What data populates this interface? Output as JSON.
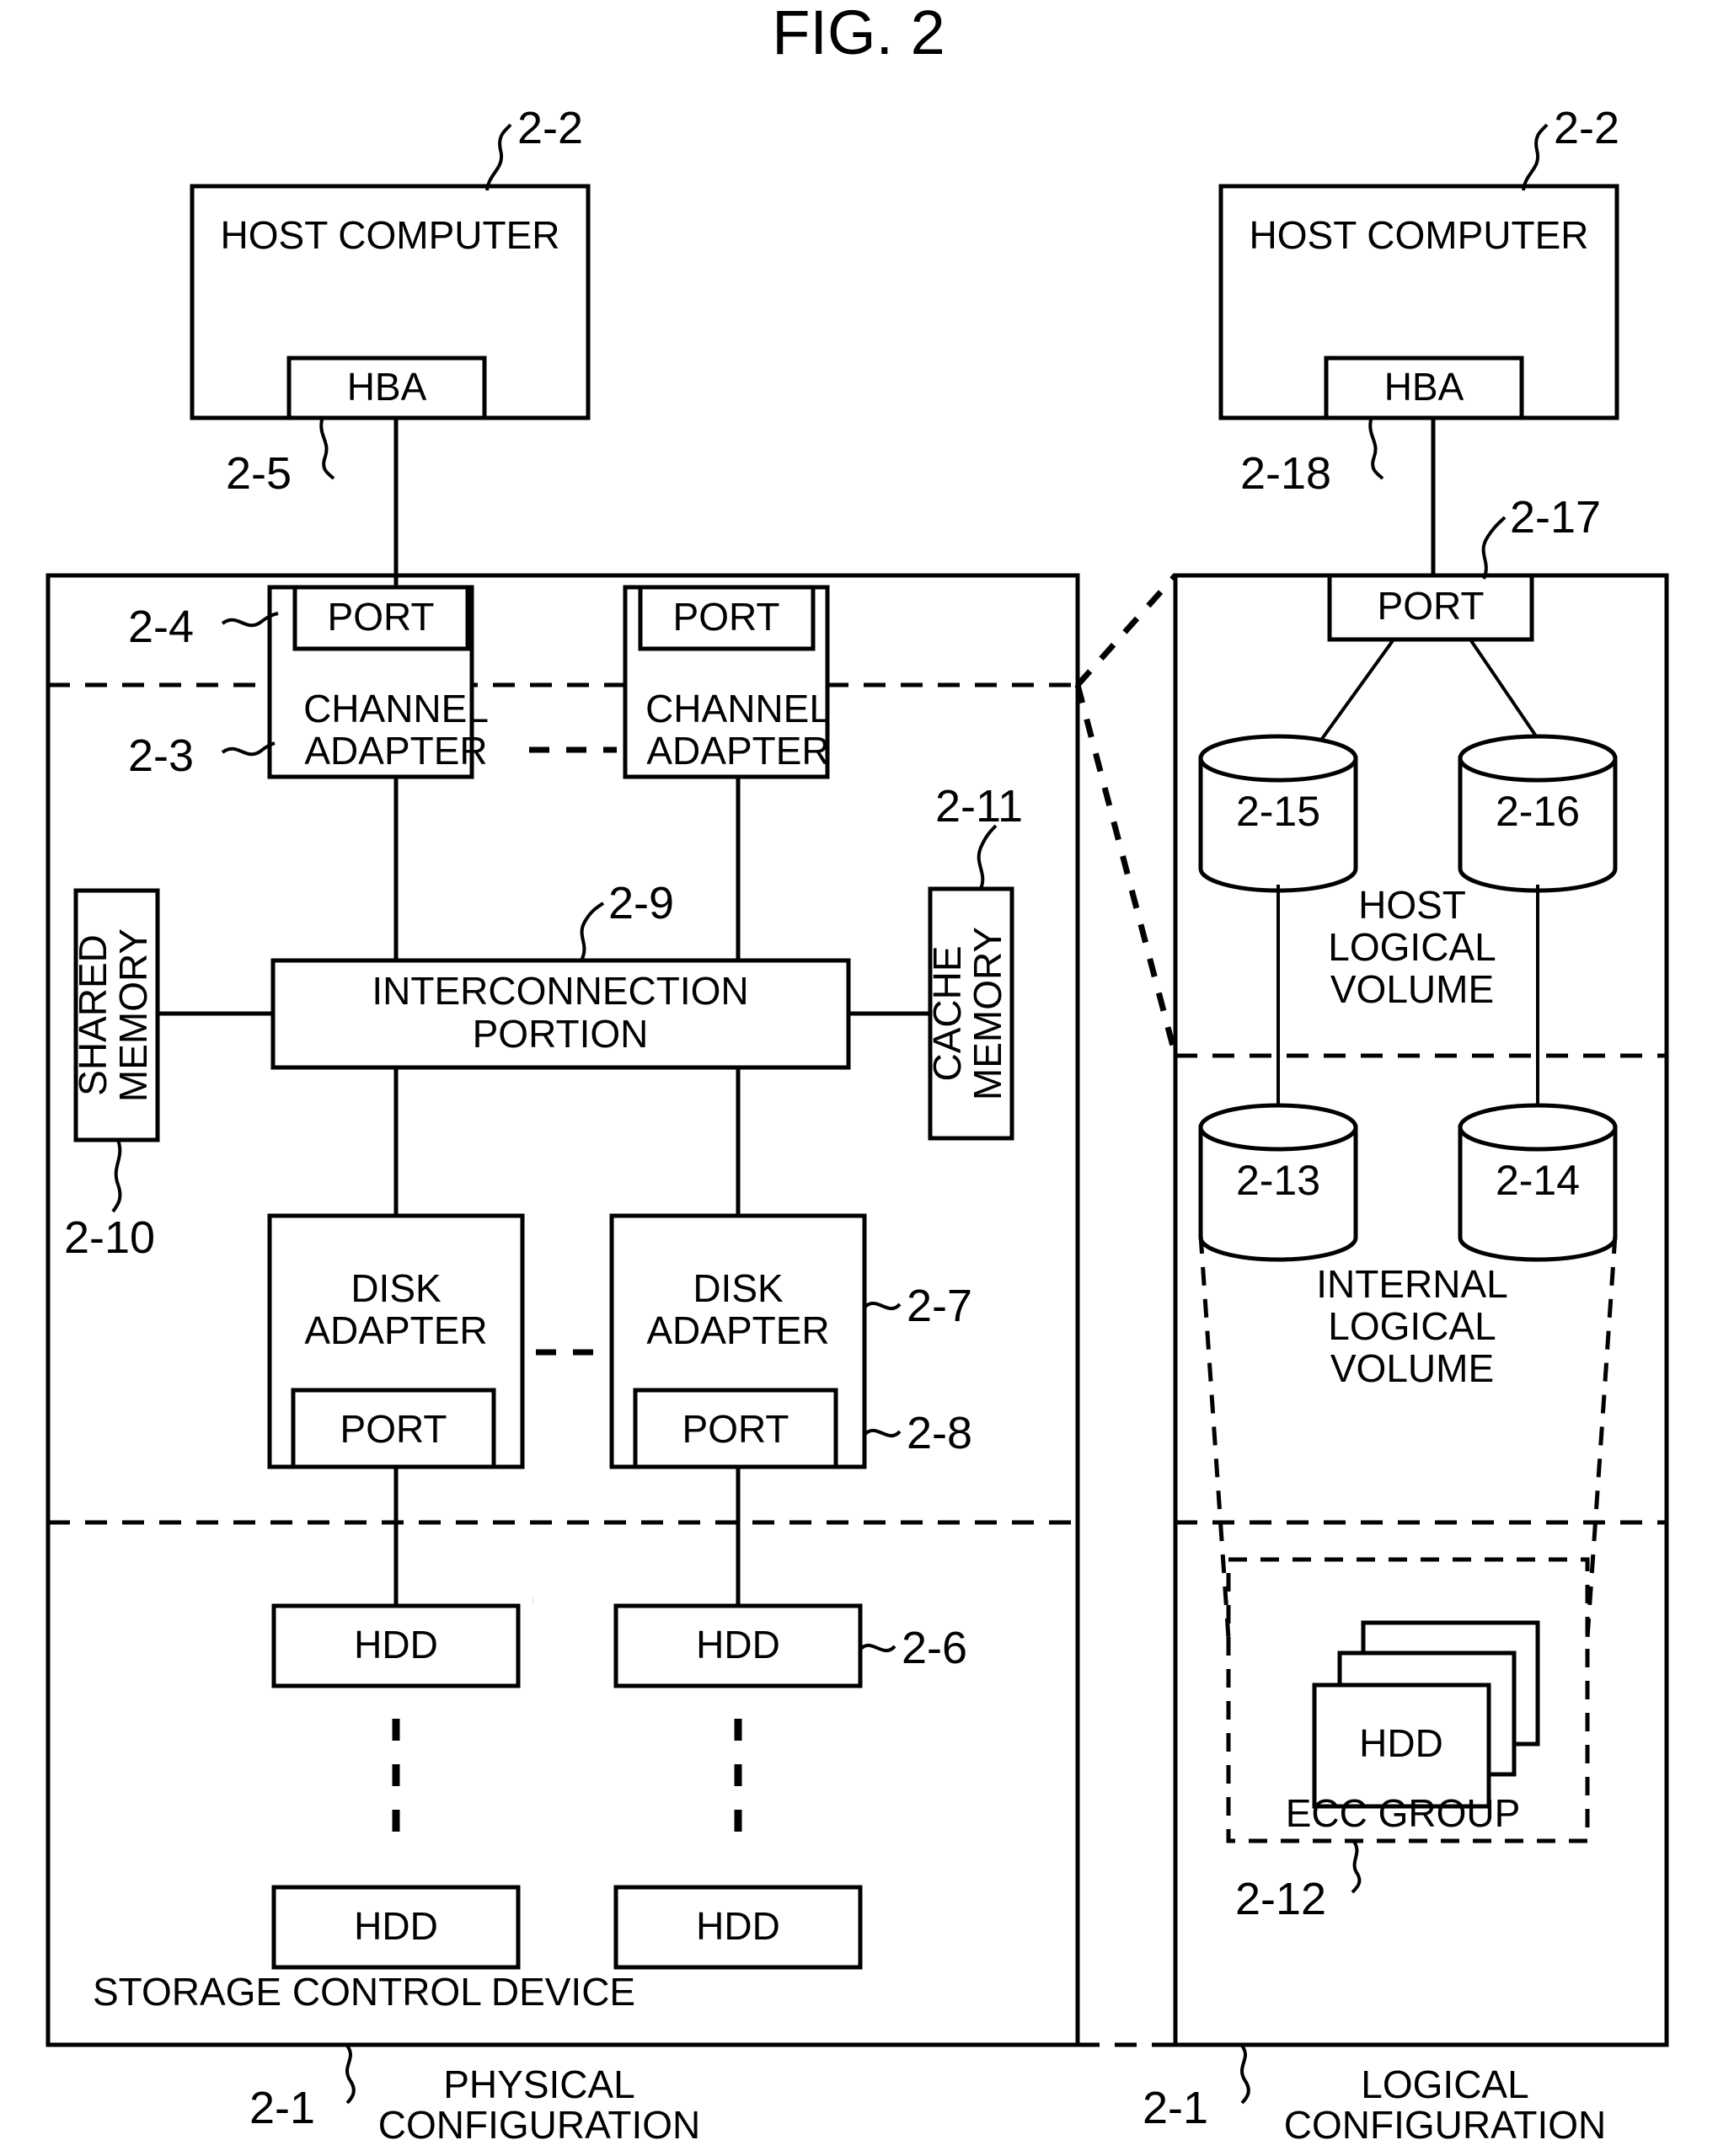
{
  "figure": {
    "title": "FIG. 2"
  },
  "left_panel": {
    "caption_ref": "2-1",
    "caption_line1": "PHYSICAL",
    "caption_line2": "CONFIGURATION",
    "device_label": "STORAGE CONTROL DEVICE",
    "host_computer": {
      "label": "HOST COMPUTER",
      "ref": "2-2",
      "hba_label": "HBA",
      "hba_ref": "2-5"
    },
    "channel_adapters": [
      {
        "port_label": "PORT",
        "line1": "CHANNEL",
        "line2": "ADAPTER"
      },
      {
        "port_label": "PORT",
        "line1": "CHANNEL",
        "line2": "ADAPTER"
      }
    ],
    "channel_port_ref": "2-4",
    "channel_adapter_ref": "2-3",
    "interconnection": {
      "line1": "INTERCONNECTION",
      "line2": "PORTION",
      "ref": "2-9"
    },
    "shared_memory": {
      "line1": "SHARED",
      "line2": "MEMORY",
      "ref": "2-10"
    },
    "cache_memory": {
      "line1": "CACHE",
      "line2": "MEMORY",
      "ref": "2-11"
    },
    "disk_adapters": [
      {
        "line1": "DISK",
        "line2": "ADAPTER",
        "port_label": "PORT"
      },
      {
        "line1": "DISK",
        "line2": "ADAPTER",
        "port_label": "PORT"
      }
    ],
    "disk_adapter_ref": "2-7",
    "disk_port_ref": "2-8",
    "hdds": [
      {
        "label": "HDD"
      },
      {
        "label": "HDD"
      },
      {
        "label": "HDD"
      },
      {
        "label": "HDD"
      }
    ],
    "hdd_ref": "2-6"
  },
  "right_panel": {
    "caption_ref": "2-1",
    "caption_line1": "LOGICAL",
    "caption_line2": "CONFIGURATION",
    "host_computer": {
      "label": "HOST COMPUTER",
      "ref": "2-2",
      "hba_label": "HBA",
      "hba_ref": "2-18"
    },
    "port": {
      "label": "PORT",
      "ref": "2-17"
    },
    "host_logical_volume": {
      "line1": "HOST",
      "line2": "LOGICAL",
      "line3": "VOLUME",
      "volumes": [
        {
          "ref": "2-15"
        },
        {
          "ref": "2-16"
        }
      ]
    },
    "internal_logical_volume": {
      "line1": "INTERNAL",
      "line2": "LOGICAL",
      "line3": "VOLUME",
      "volumes": [
        {
          "ref": "2-13"
        },
        {
          "ref": "2-14"
        }
      ]
    },
    "ecc_group": {
      "label": "ECC GROUP",
      "hdd_label": "HDD",
      "ref": "2-12"
    }
  }
}
